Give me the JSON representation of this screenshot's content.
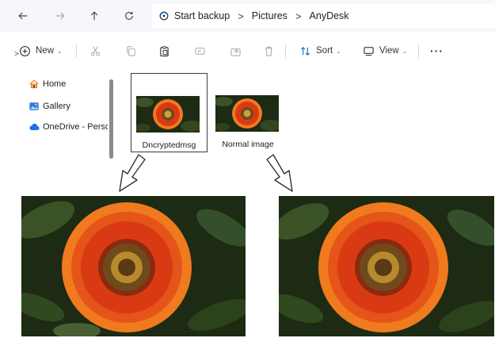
{
  "address_bar": {
    "breadcrumbs": [
      "Start backup",
      "Pictures",
      "AnyDesk"
    ],
    "separator": ">"
  },
  "toolbar": {
    "new_label": "New",
    "sort_label": "Sort",
    "view_label": "View",
    "more_label": "···",
    "caret": "⌄"
  },
  "nav_pane": {
    "items": [
      {
        "label": "Home",
        "icon": "home-icon"
      },
      {
        "label": "Gallery",
        "icon": "gallery-icon"
      },
      {
        "label": "OneDrive - Perso",
        "icon": "cloud-icon"
      }
    ],
    "expand_glyph": ">"
  },
  "files": [
    {
      "name": "Dncryptedmsg",
      "selected": true
    },
    {
      "name": "Normal image",
      "selected": false
    }
  ],
  "colors": {
    "accent_blue": "#0a6cd6",
    "onedrive_blue": "#1a73e8",
    "home_orange": "#e8913a",
    "petal_red": "#d93a14",
    "petal_orange": "#f07a1e",
    "flower_center": "#6e4a1c",
    "leaf_dark": "#1d2a14"
  }
}
